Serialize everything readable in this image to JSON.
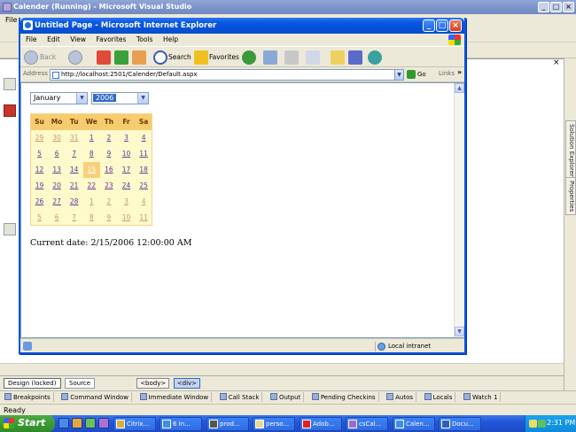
{
  "vs": {
    "title": "Calender (Running) - Microsoft Visual Studio",
    "menu_first": "File",
    "design_tab": "Design (locked)",
    "source_tab": "Source",
    "tags": [
      "<body>",
      "<div>"
    ],
    "right_tabs": [
      "Solution Explorer",
      "Properties"
    ],
    "panels": [
      "Breakpoints",
      "Command Window",
      "Immediate Window",
      "Call Stack",
      "Output",
      "Pending Checkins",
      "Autos",
      "Locals",
      "Watch 1"
    ],
    "status": "Ready"
  },
  "ie": {
    "title": "Untitled Page - Microsoft Internet Explorer",
    "menu": [
      "File",
      "Edit",
      "View",
      "Favorites",
      "Tools",
      "Help"
    ],
    "toolbar": {
      "back": "Back",
      "search": "Search",
      "favorites": "Favorites"
    },
    "address_label": "Address",
    "address": "http://localhost:2501/Calender/Default.aspx",
    "go": "Go",
    "links": "Links",
    "zone": "Local intranet"
  },
  "page": {
    "month_select": "January",
    "year_select": "2006",
    "weekdays": [
      "Su",
      "Mo",
      "Tu",
      "We",
      "Th",
      "Fr",
      "Sa"
    ],
    "weeks": [
      [
        "29",
        "30",
        "31",
        "1",
        "2",
        "3",
        "4"
      ],
      [
        "5",
        "6",
        "7",
        "8",
        "9",
        "10",
        "11"
      ],
      [
        "12",
        "13",
        "14",
        "15",
        "16",
        "17",
        "18"
      ],
      [
        "19",
        "20",
        "21",
        "22",
        "23",
        "24",
        "25"
      ],
      [
        "26",
        "27",
        "28",
        "1",
        "2",
        "3",
        "4"
      ],
      [
        "5",
        "6",
        "7",
        "8",
        "9",
        "10",
        "11"
      ]
    ],
    "other_month_flags": [
      [
        true,
        true,
        true,
        false,
        false,
        false,
        false
      ],
      [
        false,
        false,
        false,
        false,
        false,
        false,
        false
      ],
      [
        false,
        false,
        false,
        false,
        false,
        false,
        false
      ],
      [
        false,
        false,
        false,
        false,
        false,
        false,
        false
      ],
      [
        false,
        false,
        false,
        true,
        true,
        true,
        true
      ],
      [
        true,
        true,
        true,
        true,
        true,
        true,
        true
      ]
    ],
    "selected_day": "15",
    "current_date": "Current date: 2/15/2006 12:00:00 AM"
  },
  "taskbar": {
    "start": "Start",
    "tasks": [
      "Citrix...",
      "6 In...",
      "prod...",
      "perso...",
      "Adob...",
      "csCal...",
      "Calen...",
      "Docu..."
    ],
    "clock": "2:31 PM"
  },
  "colors": {
    "calendar_header": "#f6cc71",
    "calendar_bg": "#fffacc",
    "calendar_today": "#f9cf7d",
    "link_day": "#663399",
    "ie_titlebar": "#0a58e2"
  }
}
